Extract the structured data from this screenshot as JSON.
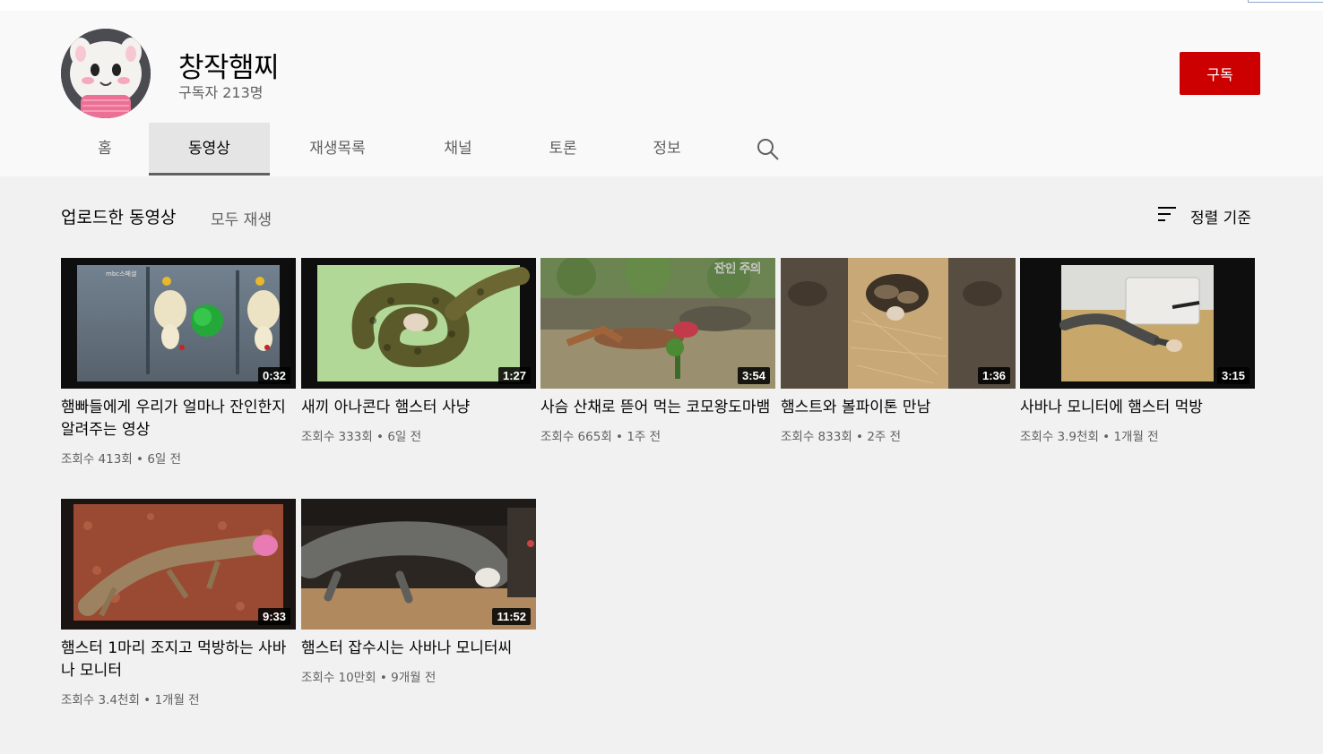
{
  "channel": {
    "name": "창작햄찌",
    "subscribers": "구독자 213명",
    "subscribe_label": "구독"
  },
  "tabs": [
    {
      "label": "홈",
      "active": false
    },
    {
      "label": "동영상",
      "active": true
    },
    {
      "label": "재생목록",
      "active": false
    },
    {
      "label": "채널",
      "active": false
    },
    {
      "label": "토론",
      "active": false
    },
    {
      "label": "정보",
      "active": false
    }
  ],
  "section": {
    "title": "업로드한 동영상",
    "play_all": "모두 재생",
    "sort_label": "정렬 기준"
  },
  "videos": [
    {
      "title": "햄빠들에게 우리가 얼마나 잔인한지 알려주는 영상",
      "duration": "0:32",
      "views": "조회수 413회",
      "age": "6일 전"
    },
    {
      "title": "새끼 아나콘다 햄스터 사냥",
      "duration": "1:27",
      "views": "조회수 333회",
      "age": "6일 전"
    },
    {
      "title": "사슴 산채로 뜯어 먹는 코모왕도마뱀",
      "duration": "3:54",
      "views": "조회수 665회",
      "age": "1주 전",
      "overlay_text": "잔인 주의"
    },
    {
      "title": "햄스트와 볼파이톤 만남",
      "duration": "1:36",
      "views": "조회수 833회",
      "age": "2주 전"
    },
    {
      "title": "사바나 모니터에 햄스터 먹방",
      "duration": "3:15",
      "views": "조회수 3.9천회",
      "age": "1개월 전"
    },
    {
      "title": "햄스터 1마리 조지고 먹방하는 사바나 모니터",
      "duration": "9:33",
      "views": "조회수 3.4천회",
      "age": "1개월 전"
    },
    {
      "title": "햄스터 잡수시는 사바나 모니터씨",
      "duration": "11:52",
      "views": "조회수 10만회",
      "age": "9개월 전"
    }
  ],
  "meta_separator": "•",
  "colors": {
    "subscribe_bg": "#cc0000",
    "page_bg": "#f9f9f9",
    "content_bg": "#f1f1f1",
    "active_tab_bg": "#e5e5e5"
  },
  "icons": {
    "search": "search-icon",
    "sort": "sort-icon"
  }
}
